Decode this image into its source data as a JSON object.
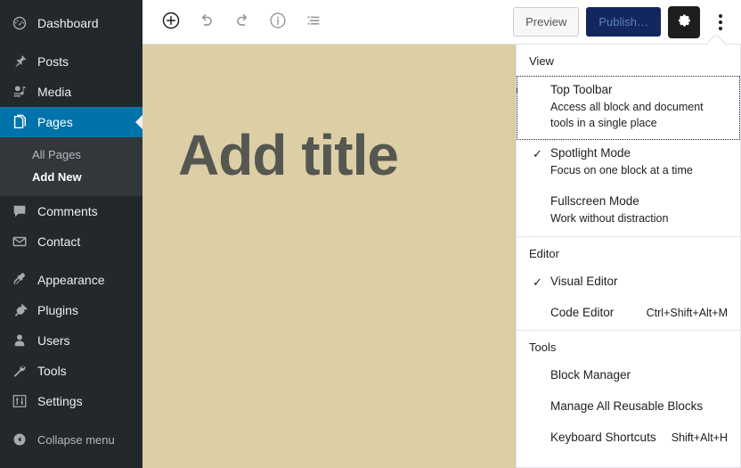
{
  "sidebar": {
    "items": [
      {
        "label": "Dashboard",
        "icon": "dashboard-icon",
        "name": "dashboard"
      },
      {
        "label": "Posts",
        "icon": "pin-icon",
        "name": "posts"
      },
      {
        "label": "Media",
        "icon": "media-icon",
        "name": "media"
      },
      {
        "label": "Pages",
        "icon": "pages-icon",
        "name": "pages",
        "current": true
      },
      {
        "label": "Comments",
        "icon": "comments-icon",
        "name": "comments"
      },
      {
        "label": "Contact",
        "icon": "envelope-icon",
        "name": "contact"
      },
      {
        "label": "Appearance",
        "icon": "appearance-icon",
        "name": "appearance"
      },
      {
        "label": "Plugins",
        "icon": "plugin-icon",
        "name": "plugins"
      },
      {
        "label": "Users",
        "icon": "user-icon",
        "name": "users"
      },
      {
        "label": "Tools",
        "icon": "wrench-icon",
        "name": "tools"
      },
      {
        "label": "Settings",
        "icon": "settings-icon",
        "name": "settings"
      }
    ],
    "submenu": [
      {
        "label": "All Pages",
        "current": false
      },
      {
        "label": "Add New",
        "current": true
      }
    ],
    "collapse_label": "Collapse menu",
    "highlight_color": "#0073aa",
    "background_color": "#23282d"
  },
  "toolbar": {
    "left_buttons": [
      {
        "name": "add-block-button",
        "icon": "plus-circle-icon",
        "label": "Add block"
      },
      {
        "name": "undo-button",
        "icon": "undo-icon",
        "label": "Undo"
      },
      {
        "name": "redo-button",
        "icon": "redo-icon",
        "label": "Redo"
      },
      {
        "name": "details-button",
        "icon": "info-icon",
        "label": "Details"
      },
      {
        "name": "list-view-button",
        "icon": "list-view-icon",
        "label": "List view"
      }
    ],
    "preview_label": "Preview",
    "publish_label": "Publish…",
    "settings_icon": "gear-icon",
    "more_icon": "kebab-menu-icon",
    "publish_bg": "#13275e",
    "publish_text_color": "#5b7fb8"
  },
  "canvas": {
    "title_placeholder": "Add title",
    "background_color": "#dccfa6",
    "title_color": "#555750"
  },
  "more_menu": {
    "groups": [
      {
        "label": "View",
        "items": [
          {
            "title": "Top Toolbar",
            "desc": "Access all block and document tools in a single place",
            "checked": false,
            "focused": true,
            "shortcut": ""
          },
          {
            "title": "Spotlight Mode",
            "desc": "Focus on one block at a time",
            "checked": true,
            "focused": false,
            "shortcut": ""
          },
          {
            "title": "Fullscreen Mode",
            "desc": "Work without distraction",
            "checked": false,
            "focused": false,
            "shortcut": ""
          }
        ]
      },
      {
        "label": "Editor",
        "items": [
          {
            "title": "Visual Editor",
            "desc": "",
            "checked": true,
            "focused": false,
            "shortcut": ""
          },
          {
            "title": "Code Editor",
            "desc": "",
            "checked": false,
            "focused": false,
            "shortcut": "Ctrl+Shift+Alt+M"
          }
        ]
      },
      {
        "label": "Tools",
        "items": [
          {
            "title": "Block Manager",
            "desc": "",
            "checked": false,
            "focused": false,
            "shortcut": ""
          },
          {
            "title": "Manage All Reusable Blocks",
            "desc": "",
            "checked": false,
            "focused": false,
            "shortcut": ""
          },
          {
            "title": "Keyboard Shortcuts",
            "desc": "",
            "checked": false,
            "focused": false,
            "shortcut": "Shift+Alt+H"
          }
        ]
      }
    ],
    "check_glyph": "✓"
  },
  "scrollbar": {
    "up_arrow": "scroll-up-arrow"
  }
}
